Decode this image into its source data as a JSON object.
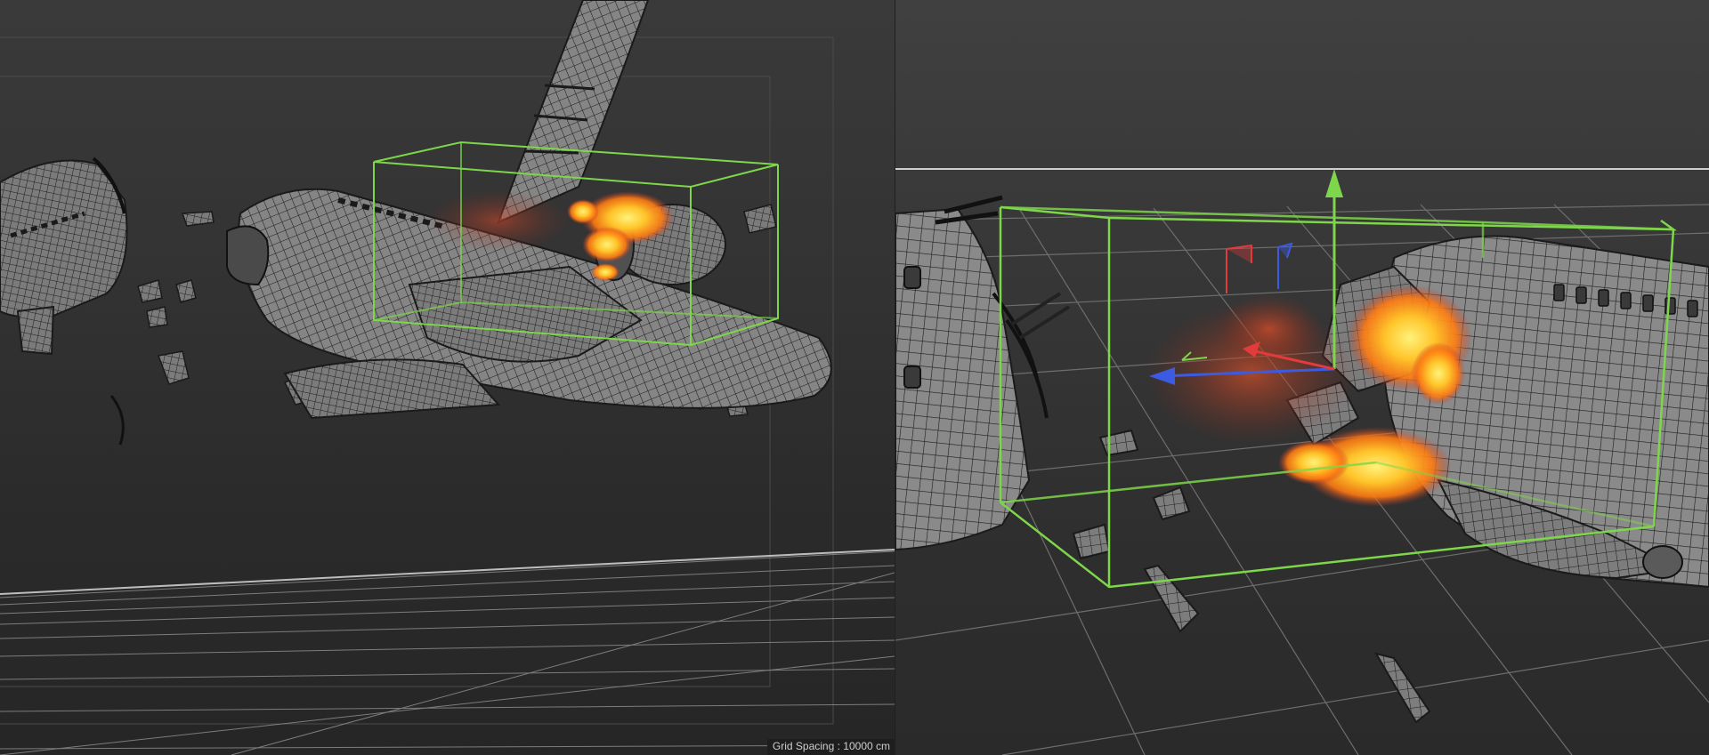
{
  "viewports": [
    {
      "id": "left",
      "grid": {
        "label": "Grid Spacing",
        "value": "10000 cm",
        "separator": " : "
      },
      "selection": {
        "type": "bounding-box",
        "color": "#7ed64a"
      }
    },
    {
      "id": "right",
      "selection": {
        "type": "bounding-box",
        "color": "#7ed64a"
      },
      "gizmo": {
        "type": "move-manipulator",
        "axis_colors": {
          "x": "#e23b3b",
          "y": "#7ed64a",
          "z": "#3b5be2"
        }
      }
    }
  ],
  "colors": {
    "wireframe": "#1a1a1a",
    "mesh_fill": "#7a7a7a",
    "fire_core": "#ffd43b",
    "fire_mid": "#ff8a1a",
    "fire_smoke": "#c0392b"
  },
  "icons": [
    "grid-icon"
  ]
}
